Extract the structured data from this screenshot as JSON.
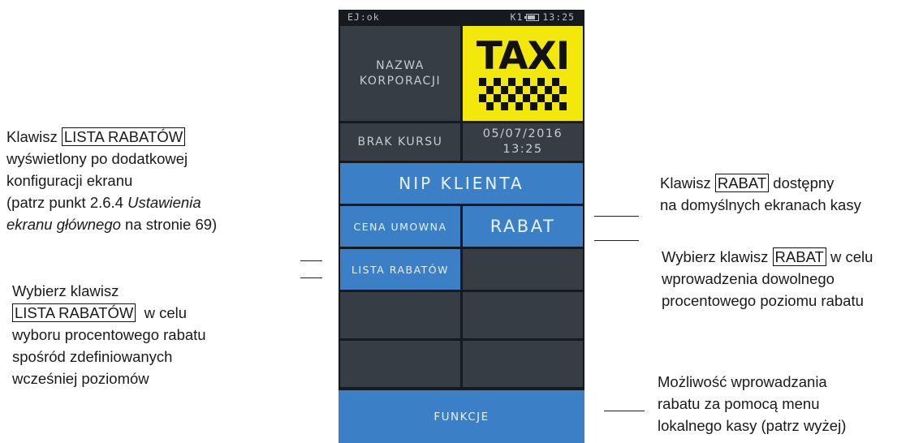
{
  "device": {
    "status_left": "EJ:ok",
    "status_right": "K1",
    "clock": "13:25",
    "corporation": "NAZWA KORPORACJI",
    "logo_text": "TAXI",
    "no_ride": "BRAK KURSU",
    "date": "05/07/2016",
    "time": "13:25",
    "nip_button": "NIP KLIENTA",
    "agreed_price_button": "CENA UMOWNA",
    "discount_button": "RABAT",
    "discount_list_button": "LISTA RABATÓW",
    "functions_button": "FUNKCJE"
  },
  "notes": {
    "left_top": {
      "prefix": "Klawisz ",
      "key": "LISTA RABATÓW",
      "line2": "wyświetlony po dodatkowej",
      "line3": "konfiguracji ekranu",
      "line4_a": "(patrz punkt 2.6.4 ",
      "line4_b": "Ustawienia",
      "line5_a": "ekranu głównego",
      "line5_b": " na stronie 69)"
    },
    "left_bottom": {
      "line1": "Wybierz klawisz",
      "key": "LISTA RABATÓW",
      "after": "  w celu",
      "line3": "wyboru procentowego rabatu",
      "line4": "spośród zdefiniowanych",
      "line5": "wcześniej poziomów"
    },
    "right_1": {
      "prefix": "Klawisz ",
      "key": "RABAT",
      "after": " dostępny",
      "line2": "na domyślnych ekranach kasy"
    },
    "right_2": {
      "prefix": "Wybierz klawisz ",
      "key": "RABAT",
      "after": " w celu",
      "line2": "wprowadzenia dowolnego",
      "line3": "procentowego poziomu rabatu"
    },
    "right_3": {
      "line1": "Możliwość wprowadzania",
      "line2": "rabatu za pomocą menu",
      "line3": "lokalnego kasy (patrz wyżej)"
    }
  }
}
